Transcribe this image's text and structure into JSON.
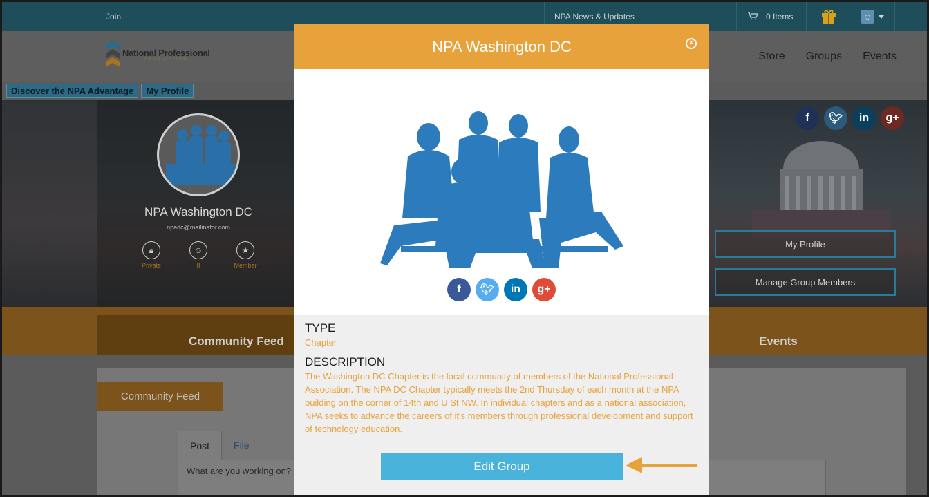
{
  "topbar": {
    "join": "Join",
    "news": "NPA News & Updates",
    "cart": "0 Items"
  },
  "logo": {
    "name": "National Professional",
    "sub": "ASSOCIATION"
  },
  "nav": [
    "Store",
    "Groups",
    "Events"
  ],
  "quick_links": [
    "Discover the NPA Advantage",
    "My Profile"
  ],
  "profile": {
    "name": "NPA Washington DC",
    "email": "npadc@mailinator.com",
    "stats": [
      {
        "label": "Private",
        "icon": "lock-icon"
      },
      {
        "label": "8",
        "icon": "user-icon"
      },
      {
        "label": "Member",
        "icon": "star-icon"
      }
    ]
  },
  "hero_buttons": {
    "my_profile": "My Profile",
    "manage": "Manage Group Members"
  },
  "tabs": {
    "community_feed": "Community Feed",
    "events": "Events"
  },
  "content": {
    "community_feed_btn": "Community Feed",
    "post_tab": "Post",
    "file_tab": "File",
    "placeholder": "What are you working on?"
  },
  "modal": {
    "title": "NPA Washington DC",
    "type_label": "TYPE",
    "type_value": "Chapter",
    "desc_label": "DESCRIPTION",
    "desc_value": "The Washington DC Chapter is the local community of members of the National Professional Association. The NPA DC Chapter typically meets the 2nd Thursday of each month at the NPA building on the corner of 14th and U St NW. In individual chapters and as a national association, NPA seeks to advance the careers of it's members through professional development and support of technology education.",
    "edit_button": "Edit Group"
  },
  "colors": {
    "orange": "#e8a23c",
    "blue": "#4ab3db",
    "teal": "#1f4e5b"
  }
}
